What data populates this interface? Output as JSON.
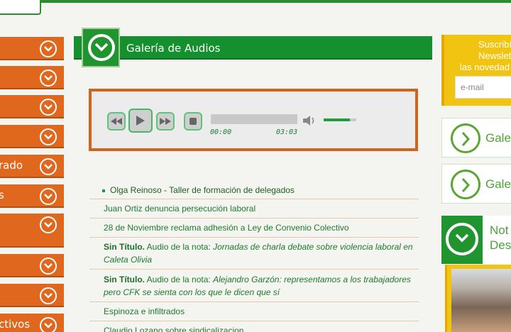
{
  "nav": {
    "items": [
      {
        "label": ""
      },
      {
        "label": ""
      },
      {
        "label": ""
      },
      {
        "label": ""
      },
      {
        "label": "rado"
      },
      {
        "label": "s"
      },
      {
        "label": ""
      },
      {
        "label": ""
      },
      {
        "label": ""
      },
      {
        "label": "ctivos"
      }
    ]
  },
  "gallery": {
    "title": "Galería de Audios"
  },
  "player": {
    "current_time": "00:00",
    "duration": "03:03",
    "progress": 0,
    "volume": 0.8
  },
  "tracks": [
    {
      "text": "Olga Reinoso - Taller de formación de delegados"
    },
    {
      "text": "Juan Ortiz denuncia persecución laboral"
    },
    {
      "text": "28 de Noviembre reclama adhesión a Ley de Convenio Colectivo"
    },
    {
      "bold": "Sin Título.",
      "prefix": " Audio de la nota: ",
      "italic": "Jornadas de charla debate sobre violencia laboral en Caleta Olivia"
    },
    {
      "bold": "Sin Título.",
      "prefix": " Audio de la nota: ",
      "italic": "Alejandro Garzón: representamos a los trabajadores pero CFK se sienta con los que le dicen que sí"
    },
    {
      "text": "Espinoza e infiltrados"
    },
    {
      "text": "Claudio Lozano sobre sindicalizacion"
    }
  ],
  "sidebar": {
    "newsletter": {
      "line1": "Suscribí",
      "line2": "Newslette",
      "line3": "las novedad",
      "email_placeholder": "e-mail"
    },
    "card1": {
      "label": "Gale"
    },
    "card2": {
      "label": "Gale"
    },
    "news": {
      "line1": "Not",
      "line2": "Des"
    }
  },
  "colors": {
    "nav_orange": "#e0681e",
    "header_green": "#14902e",
    "accent_yellow": "#f2c412",
    "link_green": "#1f7a2f"
  }
}
